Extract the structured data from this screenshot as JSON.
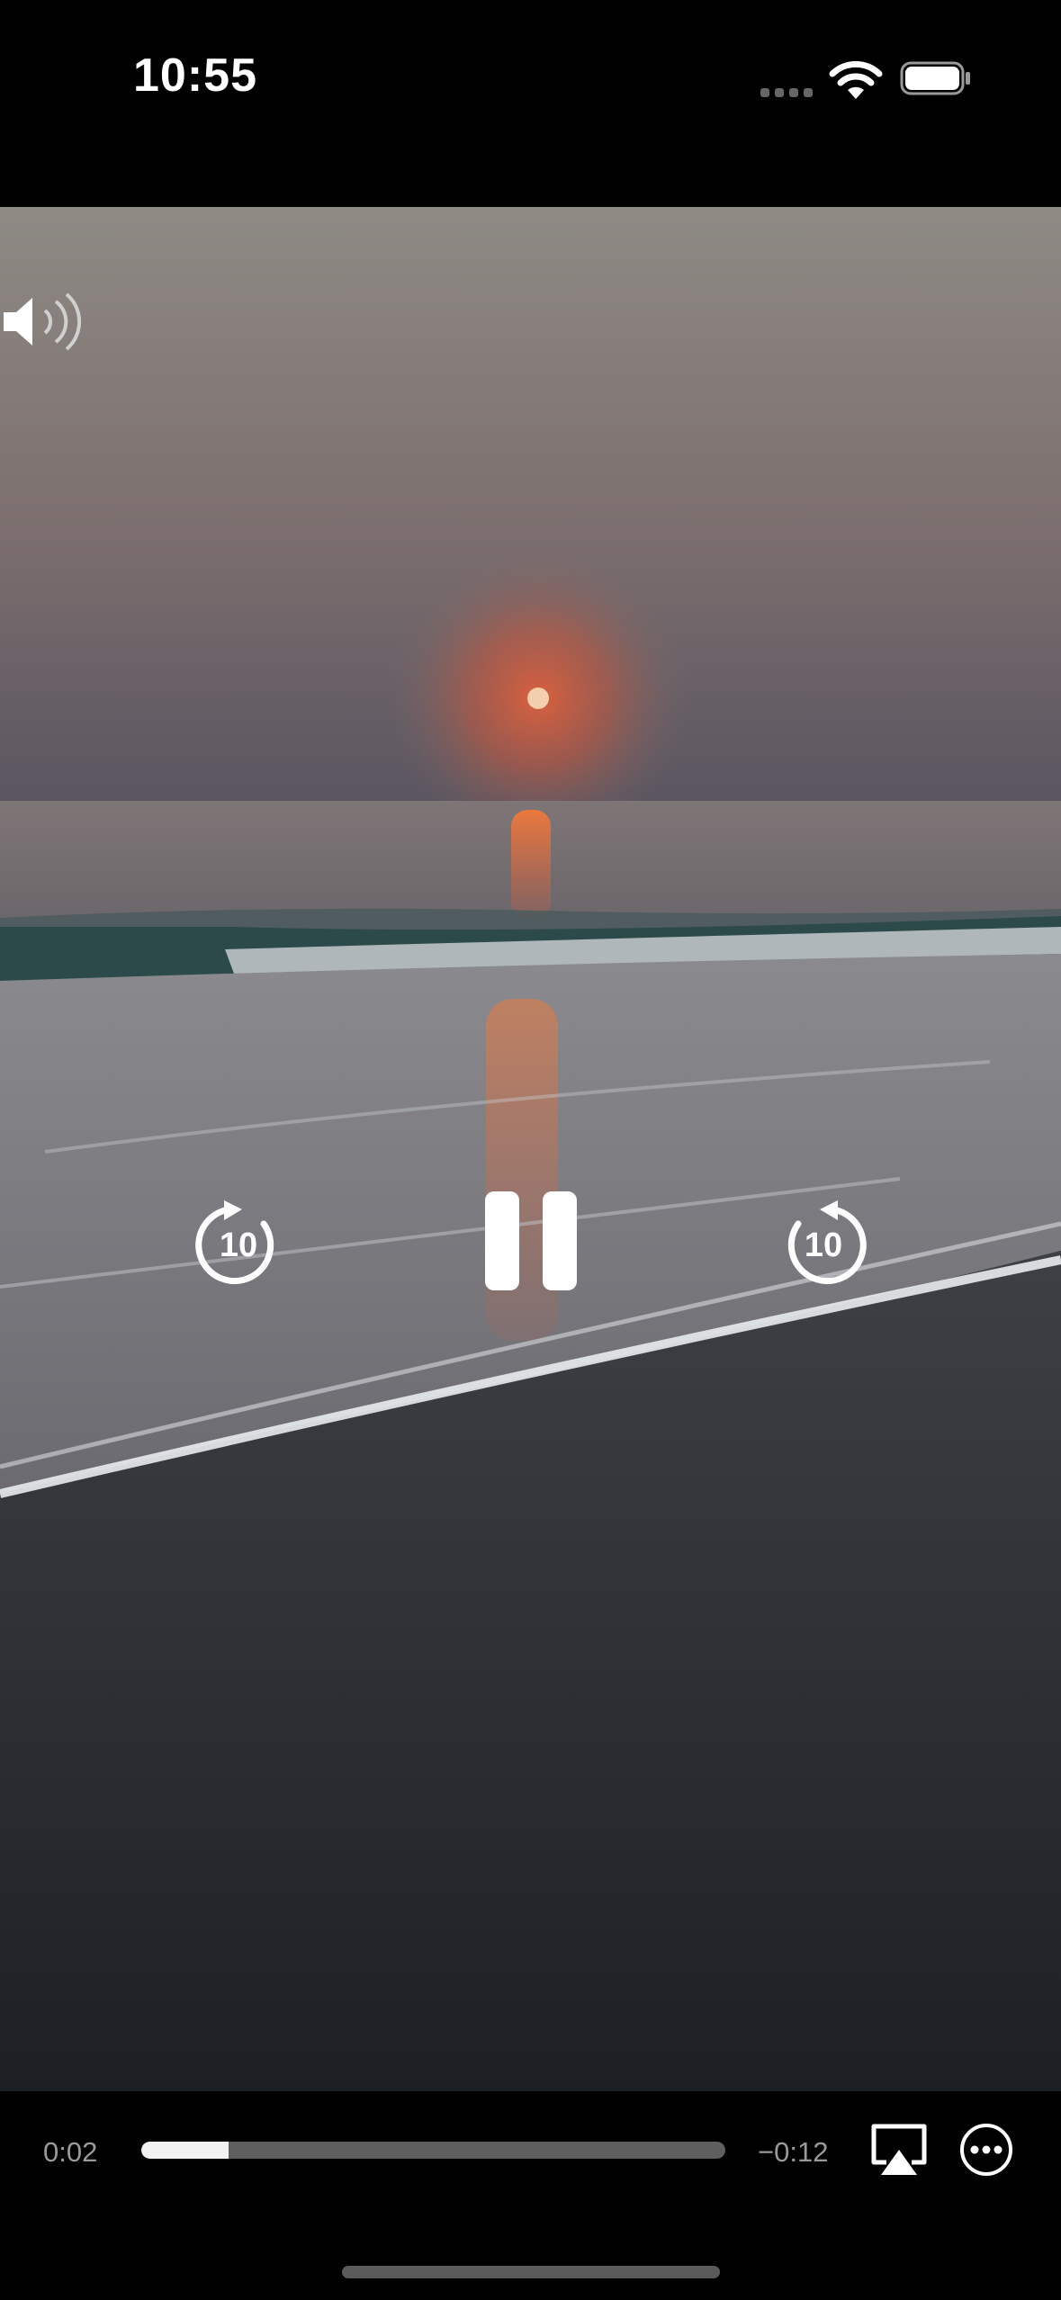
{
  "status_bar": {
    "time": "10:55",
    "icons": [
      "signal-dots-icon",
      "wifi-icon",
      "battery-icon"
    ]
  },
  "video": {
    "overlay_controls": {
      "volume_icon": "speaker-wave-icon",
      "skip_back_label": "10",
      "skip_forward_label": "10",
      "play_state_icon": "pause-icon"
    }
  },
  "player_bar": {
    "elapsed": "0:02",
    "remaining": "−0:12",
    "progress_fraction": 0.15,
    "airplay_icon": "airplay-icon",
    "more_icon": "more-ellipsis-icon"
  },
  "colors": {
    "sky_top": "#8f8a82",
    "sun": "#f5c9a0",
    "glow": "#d9543a",
    "sand": "#23272b"
  }
}
